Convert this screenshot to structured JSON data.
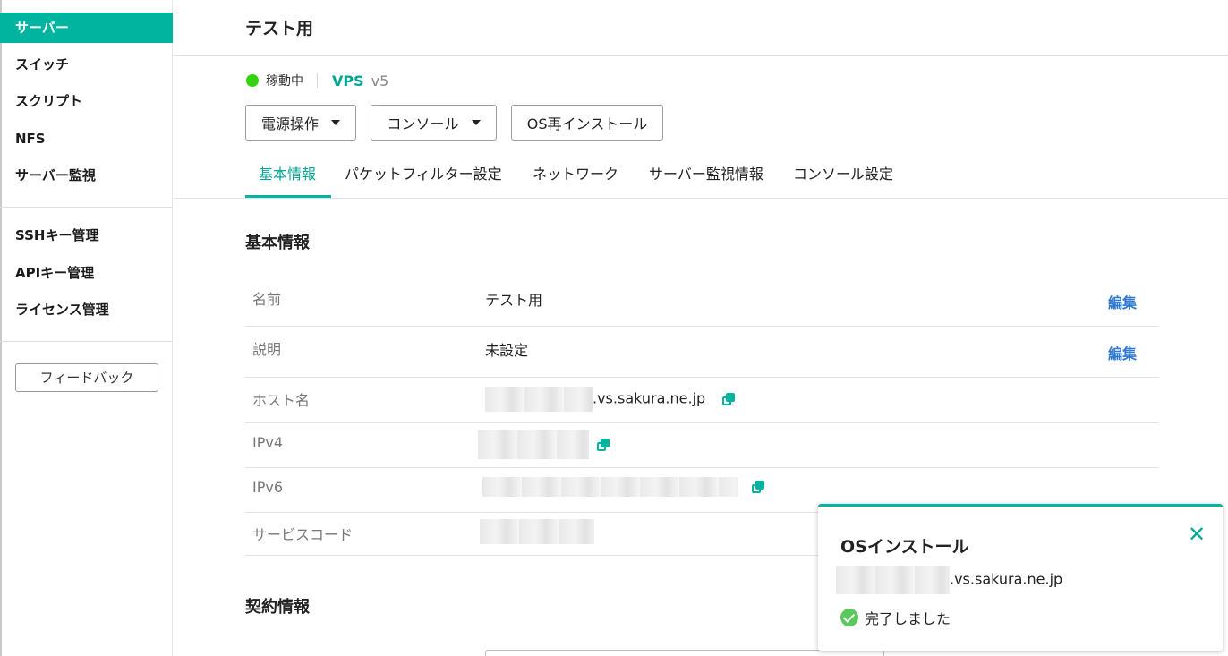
{
  "sidebar": {
    "items": [
      {
        "label": "サーバー",
        "active": true
      },
      {
        "label": "スイッチ"
      },
      {
        "label": "スクリプト"
      },
      {
        "label": "NFS"
      },
      {
        "label": "サーバー監視"
      },
      {
        "label": "SSHキー管理"
      },
      {
        "label": "APIキー管理"
      },
      {
        "label": "ライセンス管理"
      }
    ],
    "feedback_label": "フィードバック"
  },
  "header": {
    "title": "テスト用",
    "status_text": "稼動中",
    "status_color": "#32d20c",
    "plan_label": "VPS",
    "version_label": "v5"
  },
  "toolbar": {
    "power_label": "電源操作",
    "console_label": "コンソール",
    "reinstall_label": "OS再インストール"
  },
  "tabs": [
    {
      "label": "基本情報",
      "active": true
    },
    {
      "label": "パケットフィルター設定"
    },
    {
      "label": "ネットワーク"
    },
    {
      "label": "サーバー監視情報"
    },
    {
      "label": "コンソール設定"
    }
  ],
  "basic_info": {
    "title": "基本情報",
    "rows": [
      {
        "label": "名前",
        "value": "テスト用",
        "action": "編集"
      },
      {
        "label": "説明",
        "value": "未設定",
        "action": "編集"
      },
      {
        "label": "ホスト名",
        "value_suffix": ".vs.sakura.ne.jp"
      },
      {
        "label": "IPv4"
      },
      {
        "label": "IPv6"
      },
      {
        "label": "サービスコード"
      }
    ]
  },
  "contract": {
    "title": "契約情報"
  },
  "toast": {
    "title": "OSインストール",
    "host_suffix": ".vs.sakura.ne.jp",
    "status": "完了しました"
  },
  "colors": {
    "accent": "#00b4a0",
    "link": "#2e78d2"
  }
}
